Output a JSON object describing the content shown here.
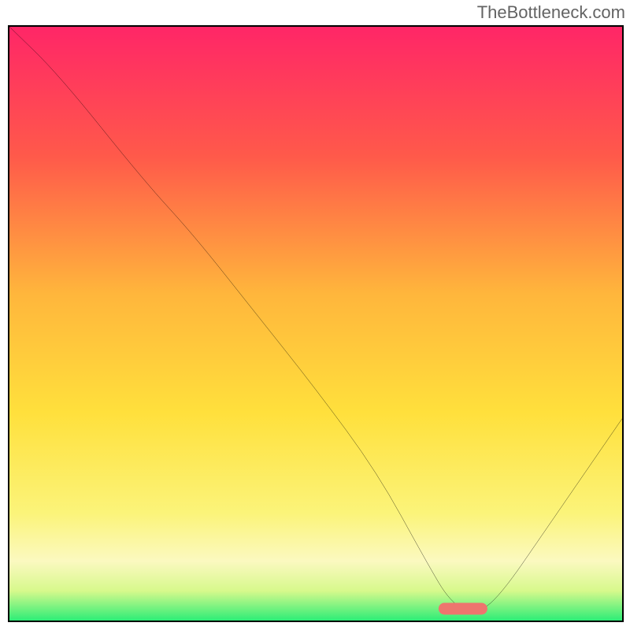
{
  "watermark": "TheBottleneck.com",
  "colors": {
    "top": "#ff2667",
    "mid_upper": "#ff7c3b",
    "mid": "#ffe03c",
    "mid_lower": "#fbf9a6",
    "band": "#e8fba6",
    "bottom": "#2ded77",
    "marker": "#ee756e",
    "line": "#000000"
  },
  "chart_data": {
    "type": "line",
    "title": "",
    "xlabel": "",
    "ylabel": "",
    "xlim": [
      0,
      100
    ],
    "ylim": [
      0,
      100
    ],
    "x": [
      0,
      8,
      22,
      30,
      40,
      50,
      60,
      68,
      72,
      76,
      80,
      88,
      100
    ],
    "values": [
      100,
      92,
      74,
      65,
      52,
      39,
      25,
      10,
      3,
      1,
      4,
      16,
      34
    ],
    "marker": {
      "x": 74,
      "y": 2,
      "w": 8,
      "h": 2
    }
  }
}
